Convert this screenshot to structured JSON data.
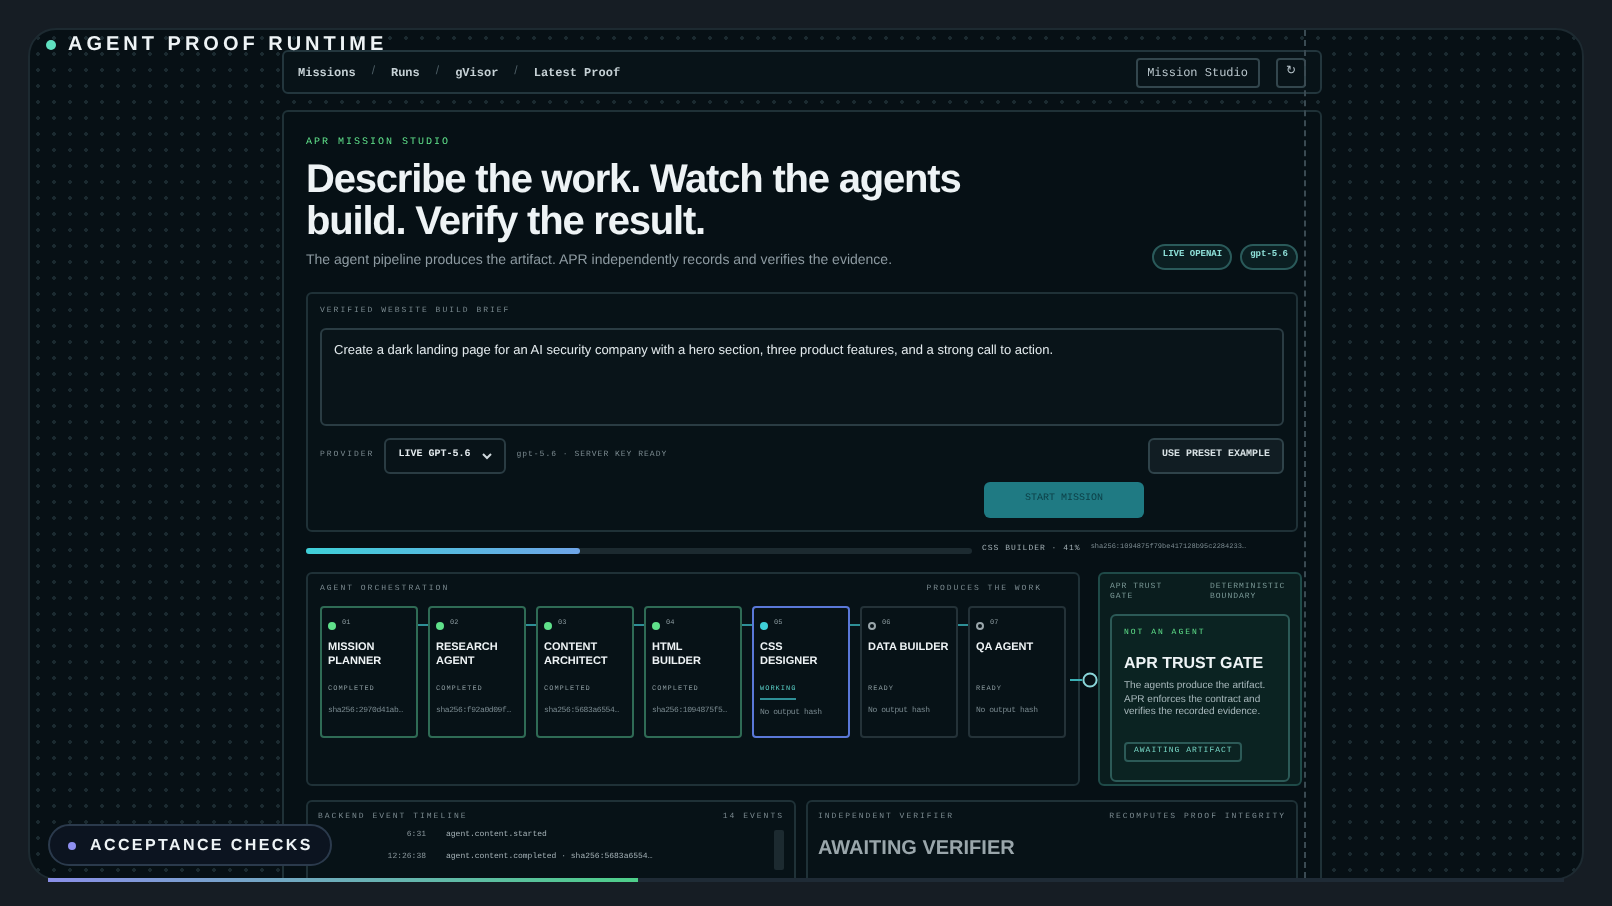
{
  "app_label": "AGENT PROOF RUNTIME",
  "breadcrumbs": [
    "Missions",
    "Runs",
    "gVisor",
    "Latest Proof"
  ],
  "breadcrumb_separator": "/",
  "nav_button": "Mission Studio",
  "nav_icon_button": "↻",
  "studio": {
    "eyebrow": "APR MISSION STUDIO",
    "heading": "Describe the work. Watch the agents build. Verify the result.",
    "subtitle": "The agent pipeline produces the artifact. APR independently records and verifies the evidence.",
    "badges": [
      "LIVE OPENAI",
      "gpt-5.6"
    ]
  },
  "brief": {
    "label": "VERIFIED WEBSITE BUILD BRIEF",
    "value": "Create a dark landing page for an AI security company with a hero section, three product features, and a strong call to action.",
    "provider_label": "PROVIDER",
    "provider_select": "LIVE GPT-5.6",
    "provider_status": "gpt-5.6 · SERVER KEY READY",
    "preset_button": "USE PRESET EXAMPLE",
    "start_button": "START MISSION"
  },
  "progress": {
    "level": 0.41,
    "label": "CSS BUILDER · 41%",
    "hash": "sha256:1094875f79be417128b95c2284233…"
  },
  "orchestration": {
    "title": "AGENT ORCHESTRATION",
    "right_label": "PRODUCES THE WORK",
    "agents": [
      {
        "number": "01",
        "name": "MISSION PLANNER",
        "status": "COMPLETED",
        "output": "sha256:2970d41ab…",
        "kind": "completed"
      },
      {
        "number": "02",
        "name": "RESEARCH AGENT",
        "status": "COMPLETED",
        "output": "sha256:f92a0d09f…",
        "kind": "completed"
      },
      {
        "number": "03",
        "name": "CONTENT ARCHITECT",
        "status": "COMPLETED",
        "output": "sha256:5683a6554…",
        "kind": "completed"
      },
      {
        "number": "04",
        "name": "HTML BUILDER",
        "status": "COMPLETED",
        "output": "sha256:1094875f5…",
        "kind": "completed"
      },
      {
        "number": "05",
        "name": "CSS DESIGNER",
        "status": "WORKING",
        "output": "No output hash",
        "kind": "working"
      },
      {
        "number": "06",
        "name": "DATA BUILDER",
        "status": "READY",
        "output": "No output hash",
        "kind": "ready"
      },
      {
        "number": "07",
        "name": "QA AGENT",
        "status": "READY",
        "output": "No output hash",
        "kind": "ready"
      }
    ]
  },
  "trust_gate": {
    "labels": [
      "APR TRUST GATE",
      "DETERMINISTIC BOUNDARY"
    ],
    "eyebrow": "NOT AN AGENT",
    "title": "APR TRUST GATE",
    "body": "The agents produce the artifact. APR enforces the contract and verifies the recorded evidence.",
    "status": "AWAITING ARTIFACT"
  },
  "timeline": {
    "title": "BACKEND EVENT TIMELINE",
    "count": "14 EVENTS",
    "events": [
      {
        "time": "6:31",
        "text": "agent.content.started"
      },
      {
        "time": "12:26:38",
        "text": "agent.content.completed · sha256:5683a6554…"
      }
    ]
  },
  "verifier": {
    "title": "INDEPENDENT VERIFIER",
    "right_label": "RECOMPUTES PROOF INTEGRITY",
    "status": "AWAITING VERIFIER"
  },
  "acceptance": "ACCEPTANCE CHECKS"
}
